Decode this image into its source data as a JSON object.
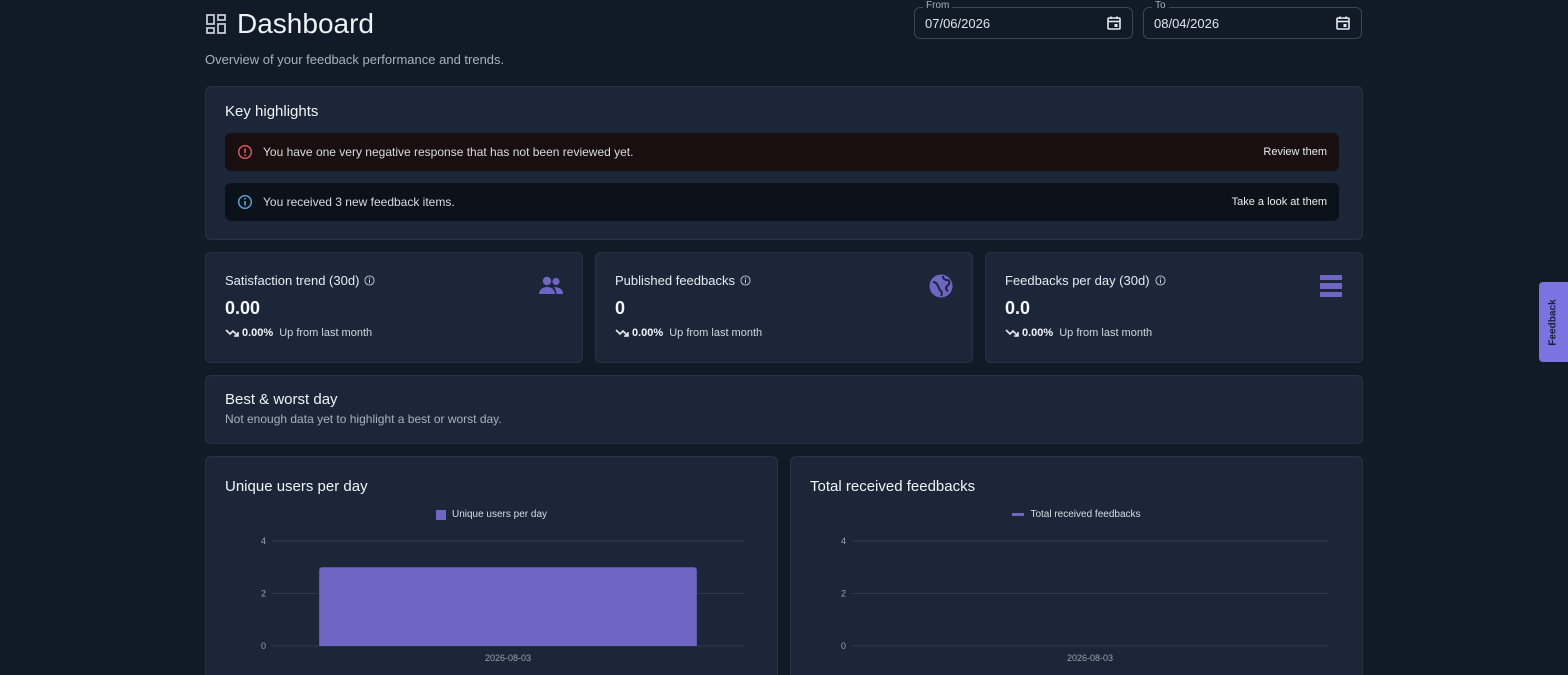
{
  "header": {
    "title": "Dashboard",
    "subtitle": "Overview of your feedback performance and trends.",
    "icon": "dashboard-icon"
  },
  "date_range": {
    "from_label": "From",
    "from_value": "07/06/2026",
    "to_label": "To",
    "to_value": "08/04/2026"
  },
  "highlights": {
    "title": "Key highlights",
    "alerts": [
      {
        "type": "error",
        "icon": "error-icon",
        "text": "You have one very negative response that has not been reviewed yet.",
        "action": "Review them",
        "color": "#e35d5d"
      },
      {
        "type": "info",
        "icon": "info-icon",
        "text": "You received 3 new feedback items.",
        "action": "Take a look at them",
        "color": "#5fa9de"
      }
    ]
  },
  "stats": [
    {
      "title": "Satisfaction trend (30d)",
      "value": "0.00",
      "trend_pct": "0.00%",
      "trend_text": "Up from last month",
      "icon": "users-icon"
    },
    {
      "title": "Published feedbacks",
      "value": "0",
      "trend_pct": "0.00%",
      "trend_text": "Up from last month",
      "icon": "globe-icon"
    },
    {
      "title": "Feedbacks per day (30d)",
      "value": "0.0",
      "trend_pct": "0.00%",
      "trend_text": "Up from last month",
      "icon": "list-icon"
    }
  ],
  "best_worst": {
    "title": "Best & worst day",
    "subtitle": "Not enough data yet to highlight a best or worst day."
  },
  "charts": {
    "unique_users": {
      "title": "Unique users per day"
    },
    "total_feedbacks": {
      "title": "Total received feedbacks"
    }
  },
  "chart_data": [
    {
      "type": "bar",
      "title": "Unique users per day",
      "categories": [
        "2026-08-03"
      ],
      "series": [
        {
          "name": "Unique users per day",
          "values": [
            3
          ]
        }
      ],
      "yticks": [
        0,
        2,
        4
      ],
      "ylim": [
        0,
        4
      ],
      "grid": true,
      "legend": "top-center",
      "color": "#6f66c4"
    },
    {
      "type": "line",
      "title": "Total received feedbacks",
      "categories": [
        "2026-08-03"
      ],
      "series": [
        {
          "name": "Total received feedbacks",
          "values": []
        }
      ],
      "yticks": [
        0,
        2,
        4
      ],
      "ylim": [
        0,
        4
      ],
      "grid": true,
      "legend": "top-center",
      "color": "#6f66c4"
    }
  ],
  "feedback_tab": {
    "label": "Feedback"
  },
  "colors": {
    "background": "#111b27",
    "card": "#1b2738",
    "accent": "#6f66c4",
    "stat_icon": "#6f66c4"
  }
}
